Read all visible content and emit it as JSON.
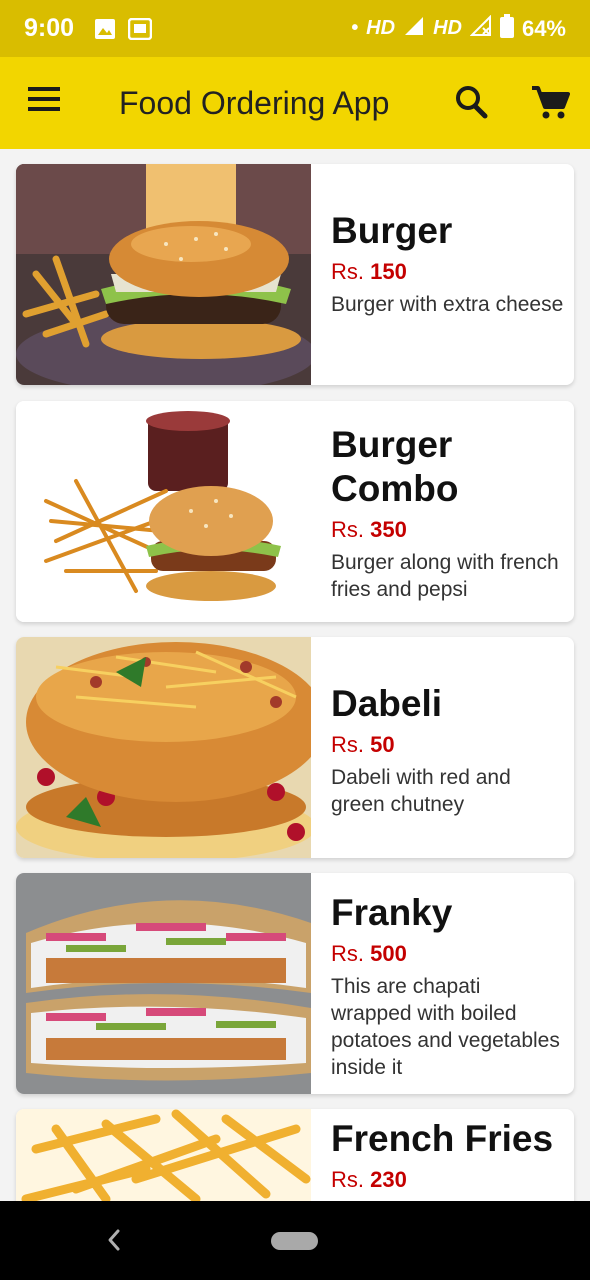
{
  "status_bar": {
    "time": "9:00",
    "network_1": "HD",
    "network_2": "HD",
    "battery": "64%",
    "icons": [
      "image-icon",
      "cast-icon",
      "dot-icon",
      "signal-icon",
      "signal-x-icon",
      "battery-icon"
    ]
  },
  "app_bar": {
    "title": "Food Ordering App",
    "icons": [
      "menu-icon",
      "search-icon",
      "cart-icon"
    ],
    "color": "#f2d600"
  },
  "items": [
    {
      "name": "Burger",
      "currency": "Rs.",
      "price": "150",
      "description": "Burger with extra cheese"
    },
    {
      "name": "Burger Combo",
      "currency": "Rs.",
      "price": "350",
      "description": "Burger along with french fries and pepsi"
    },
    {
      "name": "Dabeli",
      "currency": "Rs.",
      "price": "50",
      "description": "Dabeli with red and green chutney"
    },
    {
      "name": "Franky",
      "currency": "Rs.",
      "price": "500",
      "description": "This are chapati wrapped with boiled potatoes and vegetables inside it"
    },
    {
      "name": "French Fries",
      "currency": "Rs.",
      "price": "230",
      "description": ""
    }
  ],
  "colors": {
    "status_bar": "#d9bd00",
    "app_bar": "#f2d600",
    "price": "#c40000",
    "background": "#f3f3f3"
  }
}
